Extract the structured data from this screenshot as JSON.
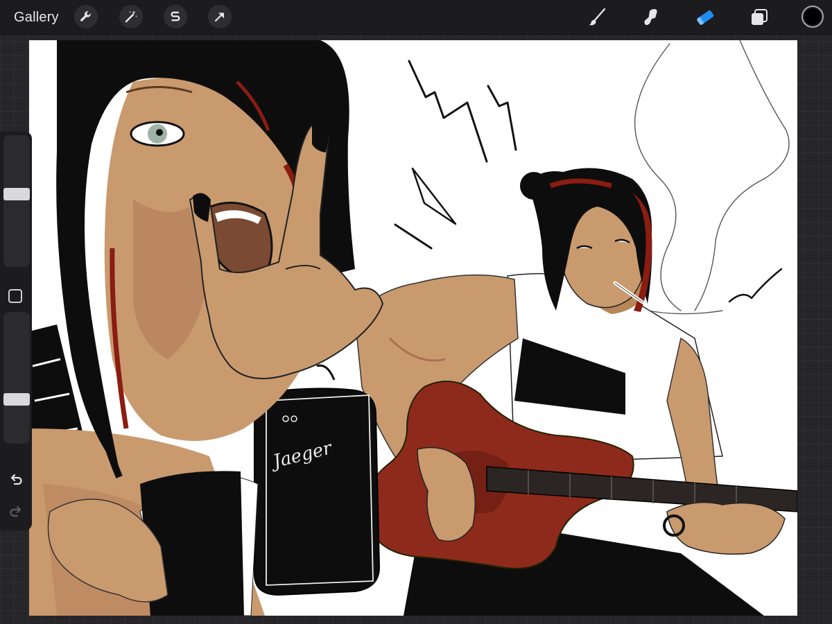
{
  "toolbar": {
    "gallery_label": "Gallery",
    "left_tools": [
      "wrench-icon",
      "magic-wand-icon",
      "selection-s-icon",
      "transform-arrow-icon"
    ],
    "right_tools": [
      "brush-icon",
      "smudge-icon",
      "eraser-icon",
      "layers-icon"
    ],
    "active_tool": "eraser-icon",
    "active_color": "#1e8cf0",
    "current_color": "#000000"
  },
  "sidebar": {
    "brush_size_level": 0.56,
    "opacity_level": 0.32,
    "tools": [
      "modify-square-icon",
      "undo-icon",
      "redo-icon"
    ]
  },
  "canvas": {
    "amp_logo_text": "Jaeger",
    "colors": {
      "skin": "#c99a6e",
      "skin_shadow": "#a8714f",
      "hair": "#0d0d0d",
      "hair_red": "#8a1c12",
      "guitar_red": "#8e2a1c",
      "eye": "#9fb4a8"
    }
  }
}
